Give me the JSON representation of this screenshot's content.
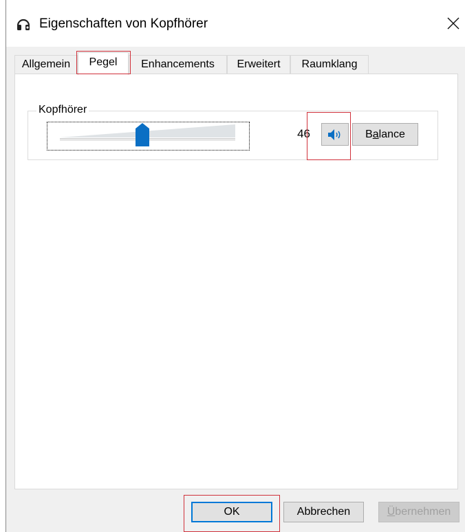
{
  "window": {
    "title": "Eigenschaften von Kopfhörer"
  },
  "tabs": [
    {
      "label": "Allgemein",
      "active": false
    },
    {
      "label": "Pegel",
      "active": true
    },
    {
      "label": "Enhancements",
      "active": false
    },
    {
      "label": "Erweitert",
      "active": false
    },
    {
      "label": "Raumklang",
      "active": false
    }
  ],
  "level_group": {
    "label": "Kopfhörer",
    "volume_value": "46",
    "volume_fraction": 0.46,
    "mute_icon": "speaker-icon",
    "balance_prefix": "B",
    "balance_accel": "a",
    "balance_suffix": "lance"
  },
  "footer": {
    "ok_label": "OK",
    "cancel_label": "Abbrechen",
    "apply_accel": "Ü",
    "apply_rest": "bernehmen"
  },
  "colors": {
    "accent": "#0078d7",
    "highlight": "#d0303a",
    "thumb": "#0b6fc4"
  }
}
